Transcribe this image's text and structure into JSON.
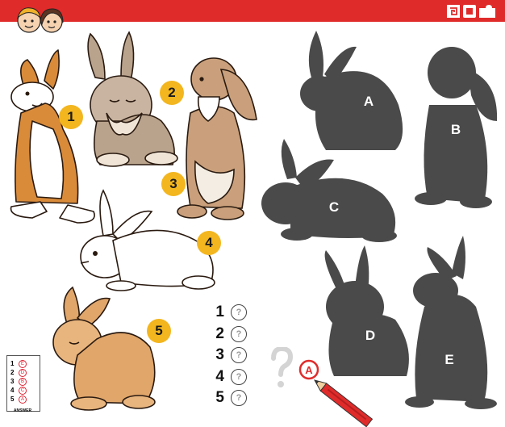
{
  "header": {
    "bar_color": "#e02b2b",
    "logo_icons": [
      "puzzle-spiral-icon",
      "puzzle-piece-icon"
    ]
  },
  "rabbits": [
    {
      "number": "1",
      "color": "#d98b3a"
    },
    {
      "number": "2",
      "color": "#b9a38d"
    },
    {
      "number": "3",
      "color": "#c9a07b"
    },
    {
      "number": "4",
      "color": "#ffffff"
    },
    {
      "number": "5",
      "color": "#e0a66a"
    }
  ],
  "shadows": [
    {
      "letter": "A"
    },
    {
      "letter": "B"
    },
    {
      "letter": "C"
    },
    {
      "letter": "D"
    },
    {
      "letter": "E"
    }
  ],
  "answer_sheet": {
    "numbers": [
      "1",
      "2",
      "3",
      "4",
      "5"
    ],
    "placeholder": "?"
  },
  "answer_key": {
    "title": "ANSWER",
    "rows": [
      {
        "num": "1",
        "letter": "E"
      },
      {
        "num": "2",
        "letter": "D"
      },
      {
        "num": "3",
        "letter": "B"
      },
      {
        "num": "4",
        "letter": "C"
      },
      {
        "num": "5",
        "letter": "A"
      }
    ]
  },
  "example": {
    "letter": "A"
  },
  "colors": {
    "badge": "#f3b61f",
    "shadow": "#4a4a4a",
    "red": "#e02b2b"
  }
}
